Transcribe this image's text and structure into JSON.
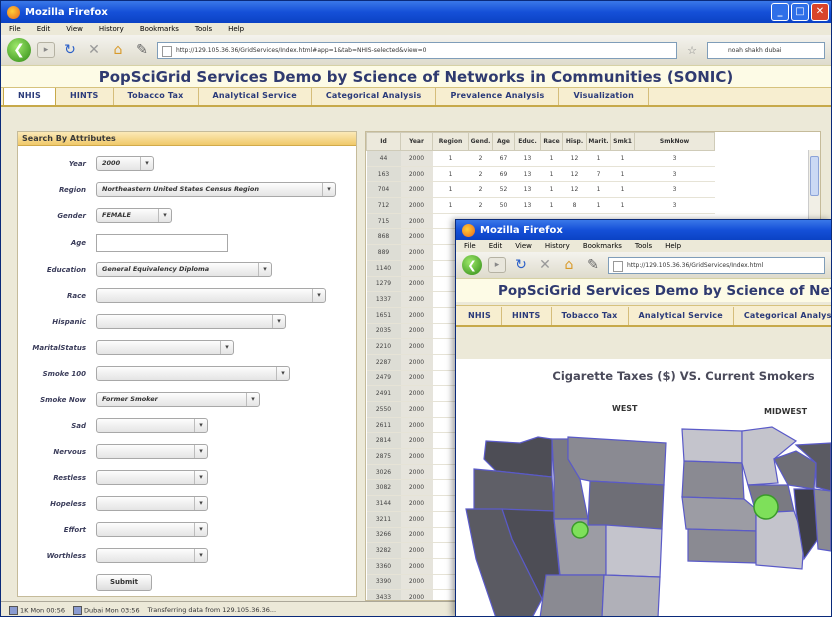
{
  "window1": {
    "title": "Mozilla Firefox",
    "menu": [
      "File",
      "Edit",
      "View",
      "History",
      "Bookmarks",
      "Tools",
      "Help"
    ],
    "url": "http://129.105.36.36/GridServices/Index.html#app=1&tab=NHIS-selected&view=0",
    "search_text": "noah shakh dubai",
    "app_title": "PopSciGrid Services Demo by Science of Networks in Communities (SONIC)",
    "tabs": [
      "NHIS",
      "HINTS",
      "Tobacco Tax",
      "Analytical Service",
      "Categorical Analysis",
      "Prevalence Analysis",
      "Visualization"
    ],
    "active_tab": "NHIS",
    "panel_title": "Search By Attributes",
    "fields": [
      {
        "label": "Year",
        "value": "2000"
      },
      {
        "label": "Region",
        "value": "Northeastern United States Census Region"
      },
      {
        "label": "Gender",
        "value": "FEMALE"
      },
      {
        "label": "Age",
        "value": ""
      },
      {
        "label": "Education",
        "value": "General Equivalency Diploma"
      },
      {
        "label": "Race",
        "value": ""
      },
      {
        "label": "Hispanic",
        "value": ""
      },
      {
        "label": "MaritalStatus",
        "value": ""
      },
      {
        "label": "Smoke 100",
        "value": ""
      },
      {
        "label": "Smoke Now",
        "value": "Former Smoker"
      },
      {
        "label": "Sad",
        "value": ""
      },
      {
        "label": "Nervous",
        "value": ""
      },
      {
        "label": "Restless",
        "value": ""
      },
      {
        "label": "Hopeless",
        "value": ""
      },
      {
        "label": "Effort",
        "value": ""
      },
      {
        "label": "Worthless",
        "value": ""
      }
    ],
    "submit_label": "Submit",
    "table": {
      "headers": [
        "Id",
        "Year",
        "Region",
        "Gend.",
        "Age",
        "Educ.",
        "Race",
        "Hisp.",
        "Marit.",
        "Smk1",
        "SmkNow"
      ],
      "rows": [
        [
          "44",
          "2000",
          "1",
          "2",
          "67",
          "13",
          "1",
          "12",
          "1",
          "1",
          "3"
        ],
        [
          "163",
          "2000",
          "1",
          "2",
          "69",
          "13",
          "1",
          "12",
          "7",
          "1",
          "3"
        ],
        [
          "704",
          "2000",
          "1",
          "2",
          "52",
          "13",
          "1",
          "12",
          "1",
          "1",
          "3"
        ],
        [
          "712",
          "2000",
          "1",
          "2",
          "50",
          "13",
          "1",
          "8",
          "1",
          "1",
          "3"
        ],
        [
          "715",
          "2000",
          "",
          "",
          "",
          "",
          "",
          "",
          "",
          "",
          ""
        ],
        [
          "868",
          "2000",
          "",
          "",
          "",
          "",
          "",
          "",
          "",
          "",
          ""
        ],
        [
          "889",
          "2000",
          "",
          "",
          "",
          "",
          "",
          "",
          "",
          "",
          ""
        ],
        [
          "1140",
          "2000",
          "",
          "",
          "",
          "",
          "",
          "",
          "",
          "",
          ""
        ],
        [
          "1279",
          "2000",
          "",
          "",
          "",
          "",
          "",
          "",
          "",
          "",
          ""
        ],
        [
          "1337",
          "2000",
          "",
          "",
          "",
          "",
          "",
          "",
          "",
          "",
          ""
        ],
        [
          "1651",
          "2000",
          "",
          "",
          "",
          "",
          "",
          "",
          "",
          "",
          ""
        ],
        [
          "2035",
          "2000",
          "",
          "",
          "",
          "",
          "",
          "",
          "",
          "",
          ""
        ],
        [
          "2210",
          "2000",
          "",
          "",
          "",
          "",
          "",
          "",
          "",
          "",
          ""
        ],
        [
          "2287",
          "2000",
          "",
          "",
          "",
          "",
          "",
          "",
          "",
          "",
          ""
        ],
        [
          "2479",
          "2000",
          "",
          "",
          "",
          "",
          "",
          "",
          "",
          "",
          ""
        ],
        [
          "2491",
          "2000",
          "",
          "",
          "",
          "",
          "",
          "",
          "",
          "",
          ""
        ],
        [
          "2550",
          "2000",
          "",
          "",
          "",
          "",
          "",
          "",
          "",
          "",
          ""
        ],
        [
          "2611",
          "2000",
          "",
          "",
          "",
          "",
          "",
          "",
          "",
          "",
          ""
        ],
        [
          "2814",
          "2000",
          "",
          "",
          "",
          "",
          "",
          "",
          "",
          "",
          ""
        ],
        [
          "2875",
          "2000",
          "",
          "",
          "",
          "",
          "",
          "",
          "",
          "",
          ""
        ],
        [
          "3026",
          "2000",
          "",
          "",
          "",
          "",
          "",
          "",
          "",
          "",
          ""
        ],
        [
          "3082",
          "2000",
          "",
          "",
          "",
          "",
          "",
          "",
          "",
          "",
          ""
        ],
        [
          "3144",
          "2000",
          "",
          "",
          "",
          "",
          "",
          "",
          "",
          "",
          ""
        ],
        [
          "3211",
          "2000",
          "",
          "",
          "",
          "",
          "",
          "",
          "",
          "",
          ""
        ],
        [
          "3266",
          "2000",
          "",
          "",
          "",
          "",
          "",
          "",
          "",
          "",
          ""
        ],
        [
          "3282",
          "2000",
          "",
          "",
          "",
          "",
          "",
          "",
          "",
          "",
          ""
        ],
        [
          "3360",
          "2000",
          "",
          "",
          "",
          "",
          "",
          "",
          "",
          "",
          ""
        ],
        [
          "3390",
          "2000",
          "",
          "",
          "",
          "",
          "",
          "",
          "",
          "",
          ""
        ],
        [
          "3433",
          "2000",
          "",
          "",
          "",
          "",
          "",
          "",
          "",
          "",
          ""
        ]
      ]
    },
    "status": [
      "1K Mon 00:56",
      "Dubai Mon 03:56",
      "Transferring data from 129.105.36.36..."
    ]
  },
  "window2": {
    "title": "Mozilla Firefox",
    "menu": [
      "File",
      "Edit",
      "View",
      "History",
      "Bookmarks",
      "Tools",
      "Help"
    ],
    "url": "http://129.105.36.36/GridServices/Index.html",
    "app_title": "PopSciGrid Services Demo by Science of Networks in Communities (SONIC)",
    "tabs": [
      "NHIS",
      "HINTS",
      "Tobacco Tax",
      "Analytical Service",
      "Categorical Analysis"
    ],
    "map_title": "Cigarette Taxes ($) VS. Current Smokers",
    "regions": [
      "WEST",
      "MIDWEST"
    ]
  },
  "colors": {
    "titlebar": "#1550d8",
    "app_title": "#2f3a70",
    "tabbar": "#f7eed0",
    "panel_head": "#f0c96a",
    "map_dark": "#4d4d55",
    "map_mid": "#8a8a92",
    "map_light": "#c4c4cc",
    "map_border": "#5a5ac8",
    "bubble": "#7ee05a"
  }
}
